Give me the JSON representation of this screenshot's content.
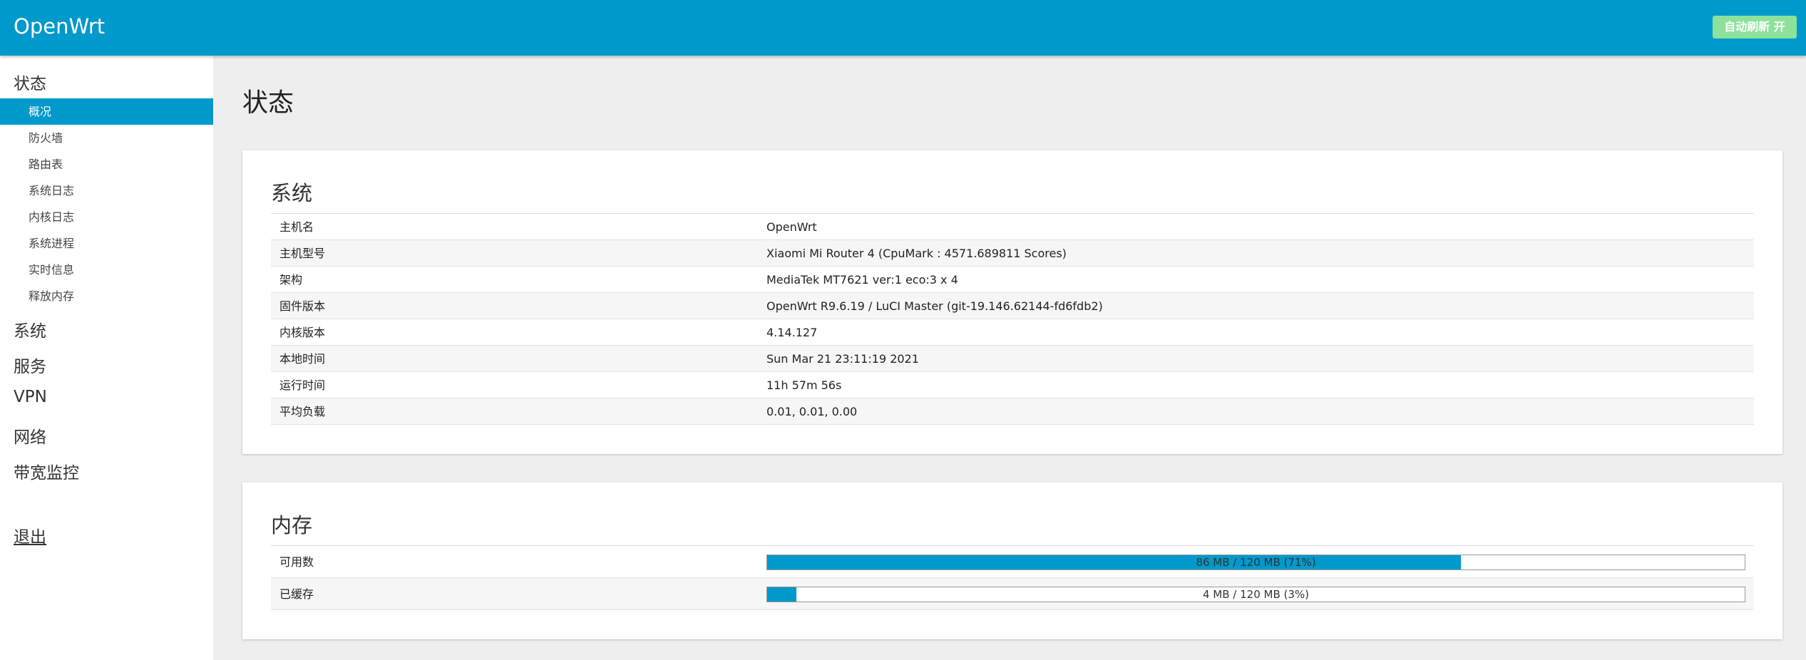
{
  "header": {
    "brand": "OpenWrt",
    "refresh_label": "自动刷新 开"
  },
  "sidebar": {
    "status": "状态",
    "status_items": [
      {
        "label": "概况",
        "active": true
      },
      {
        "label": "防火墙"
      },
      {
        "label": "路由表"
      },
      {
        "label": "系统日志"
      },
      {
        "label": "内核日志"
      },
      {
        "label": "系统进程"
      },
      {
        "label": "实时信息"
      },
      {
        "label": "释放内存"
      }
    ],
    "menus": [
      "系统",
      "服务",
      "VPN",
      "网络",
      "带宽监控"
    ],
    "logout": "退出"
  },
  "main": {
    "title": "状态",
    "system": {
      "title": "系统",
      "rows": [
        {
          "key": "主机名",
          "value": "OpenWrt"
        },
        {
          "key": "主机型号",
          "value": "Xiaomi Mi Router 4 (CpuMark : 4571.689811 Scores)"
        },
        {
          "key": "架构",
          "value": "MediaTek MT7621 ver:1 eco:3 x 4"
        },
        {
          "key": "固件版本",
          "value": "OpenWrt R9.6.19 / LuCI Master (git-19.146.62144-fd6fdb2)"
        },
        {
          "key": "内核版本",
          "value": "4.14.127"
        },
        {
          "key": "本地时间",
          "value": "Sun Mar 21 23:11:19 2021"
        },
        {
          "key": "运行时间",
          "value": "11h 57m 56s"
        },
        {
          "key": "平均负载",
          "value": "0.01, 0.01, 0.00"
        }
      ]
    },
    "memory": {
      "title": "内存",
      "rows": [
        {
          "key": "可用数",
          "label": "86 MB / 120 MB (71%)",
          "percent": 71
        },
        {
          "key": "已缓存",
          "label": "4 MB / 120 MB (3%)",
          "percent": 3
        }
      ]
    }
  },
  "colors": {
    "accent": "#0099cc",
    "refresh_button": "#8ce29a"
  }
}
